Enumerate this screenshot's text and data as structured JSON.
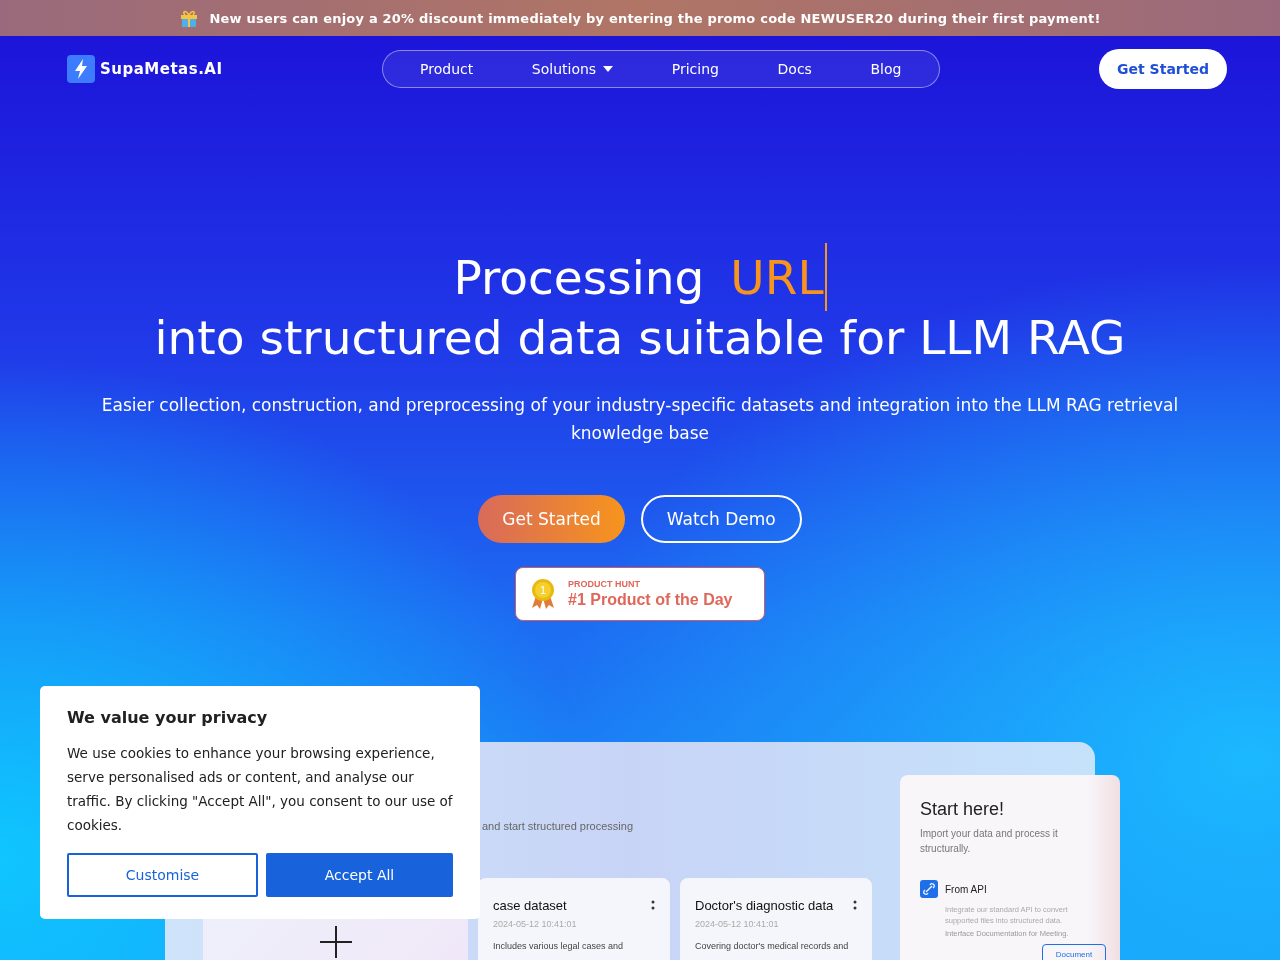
{
  "promo_banner": {
    "text": "New users can enjoy a 20% discount immediately by entering the promo code NEWUSER20 during their first payment!"
  },
  "nav": {
    "logo": "SupaMetas.AI",
    "items": [
      {
        "label": "Product",
        "has_dropdown": false
      },
      {
        "label": "Solutions",
        "has_dropdown": true
      },
      {
        "label": "Pricing",
        "has_dropdown": false
      },
      {
        "label": "Docs",
        "has_dropdown": false
      },
      {
        "label": "Blog",
        "has_dropdown": false
      }
    ],
    "cta": "Get Started"
  },
  "hero": {
    "headline_prefix": "Processing",
    "headline_typed": "URL",
    "headline_rest": "into structured data suitable for LLM RAG",
    "subtitle": "Easier collection, construction, and preprocessing of your industry-specific datasets and integration into the LLM RAG retrieval knowledge base",
    "buttons": [
      {
        "label": "Get Started",
        "kind": "primary"
      },
      {
        "label": "Watch Demo",
        "kind": "outline"
      }
    ],
    "badge": {
      "eyebrow": "PRODUCT HUNT",
      "title": "#1 Product of the Day",
      "rank": "1"
    }
  },
  "preview": {
    "subtitle": "and start structured processing",
    "datasets": [
      {
        "kind": "add"
      },
      {
        "kind": "dataset",
        "title": "case dataset",
        "date": "2024-05-12 10:41:01",
        "description": "Includes various legal cases and"
      },
      {
        "kind": "dataset",
        "title": "Doctor's diagnostic data",
        "date": "2024-05-12 10:41:01",
        "description": "Covering doctor's medical records and"
      }
    ],
    "start_card": {
      "title": "Start here!",
      "subtitle": "Import your data and process it structurally.",
      "option_title": "From API",
      "option_text": "Integrate our standard API to convert supported files into structured data.",
      "option_link": "Interface Documentation for Meeting.",
      "button": "Document"
    }
  },
  "cookie_dialog": {
    "title": "We value your privacy",
    "text": "We use cookies to enhance your browsing experience, serve personalised ads or content, and analyse our traffic. By clicking \"Accept All\", you consent to our use of cookies.",
    "buttons": [
      {
        "label": "Customise",
        "kind": "outline"
      },
      {
        "label": "Accept All",
        "kind": "primary"
      }
    ]
  }
}
